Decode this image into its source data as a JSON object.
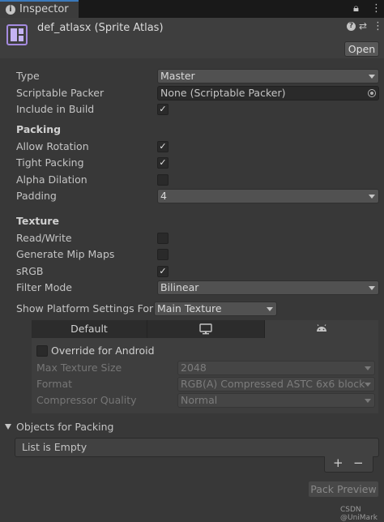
{
  "tab": {
    "icon": "info-icon",
    "label": "Inspector",
    "lock_icon": "lock-icon",
    "menu_icon": "kebab-menu-icon"
  },
  "header": {
    "title": "def_atlasx (Sprite Atlas)",
    "icon": "sprite-atlas-icon",
    "open_label": "Open",
    "help_icon": "help-icon",
    "preset_icon": "presets-icon",
    "menu_icon": "kebab-menu-icon"
  },
  "fields": {
    "type": {
      "label": "Type",
      "value": "Master"
    },
    "scriptable_packer": {
      "label": "Scriptable Packer",
      "value": "None (Scriptable Packer)"
    },
    "include_in_build": {
      "label": "Include in Build",
      "checked": true
    }
  },
  "packing": {
    "heading": "Packing",
    "allow_rotation": {
      "label": "Allow Rotation",
      "checked": true
    },
    "tight_packing": {
      "label": "Tight Packing",
      "checked": true
    },
    "alpha_dilation": {
      "label": "Alpha Dilation",
      "checked": false
    },
    "padding": {
      "label": "Padding",
      "value": "4"
    }
  },
  "texture": {
    "heading": "Texture",
    "read_write": {
      "label": "Read/Write",
      "checked": false
    },
    "generate_mip_maps": {
      "label": "Generate Mip Maps",
      "checked": false
    },
    "srgb": {
      "label": "sRGB",
      "checked": true
    },
    "filter_mode": {
      "label": "Filter Mode",
      "value": "Bilinear"
    }
  },
  "platform": {
    "label": "Show Platform Settings For",
    "value": "Main Texture",
    "tabs": [
      {
        "label": "Default",
        "icon": ""
      },
      {
        "label": "",
        "icon": "monitor-icon"
      },
      {
        "label": "",
        "icon": "android-icon"
      }
    ],
    "override": {
      "label": "Override for Android",
      "checked": false
    },
    "max_texture_size": {
      "label": "Max Texture Size",
      "value": "2048"
    },
    "format": {
      "label": "Format",
      "value": "RGB(A) Compressed ASTC 6x6 block"
    },
    "compressor_quality": {
      "label": "Compressor Quality",
      "value": "Normal"
    }
  },
  "objects": {
    "heading": "Objects for Packing",
    "empty_text": "List is Empty",
    "add_label": "+",
    "remove_label": "−"
  },
  "pack_preview_label": "Pack Preview",
  "watermark": "CSDN @UniMark",
  "colors": {
    "background": "#383838",
    "tab_accent": "#3a79bb",
    "atlas_icon": "#a58be0"
  }
}
